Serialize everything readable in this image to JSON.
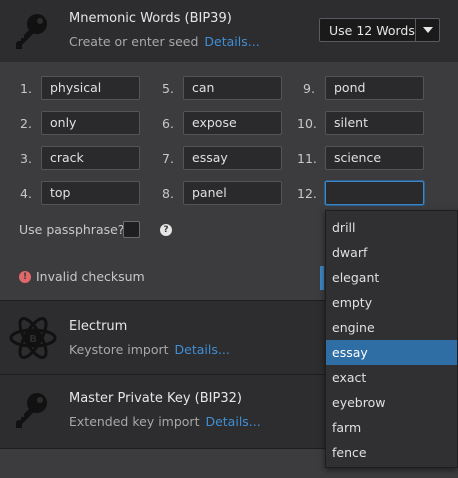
{
  "bip39": {
    "title": "Mnemonic Words (BIP39)",
    "subtitle": "Create or enter seed",
    "details": "Details...",
    "word_count": "Use 12 Words",
    "icon": "key-icon"
  },
  "words": [
    {
      "n": "1.",
      "word": "physical"
    },
    {
      "n": "2.",
      "word": "only"
    },
    {
      "n": "3.",
      "word": "crack"
    },
    {
      "n": "4.",
      "word": "top"
    },
    {
      "n": "5.",
      "word": "can"
    },
    {
      "n": "6.",
      "word": "expose"
    },
    {
      "n": "7.",
      "word": "essay"
    },
    {
      "n": "8.",
      "word": "panel"
    },
    {
      "n": "9.",
      "word": "pond"
    },
    {
      "n": "10.",
      "word": "silent"
    },
    {
      "n": "11.",
      "word": "science"
    },
    {
      "n": "12.",
      "word": ""
    }
  ],
  "passphrase": {
    "label": "Use passphrase?",
    "checked": false,
    "help_icon": "help-icon"
  },
  "error": {
    "text": "Invalid checksum",
    "icon": "error-icon",
    "color": "#e06868"
  },
  "electrum": {
    "title": "Electrum",
    "subtitle": "Keystore import",
    "details": "Details...",
    "icon": "electrum-atom-icon"
  },
  "bip32": {
    "title": "Master Private Key (BIP32)",
    "subtitle": "Extended key import",
    "details": "Details...",
    "icon": "key-icon"
  },
  "suggestions": {
    "items": [
      "drill",
      "dwarf",
      "elegant",
      "empty",
      "engine",
      "essay",
      "exact",
      "eyebrow",
      "farm",
      "fence"
    ],
    "selected": "essay"
  },
  "colors": {
    "accent": "#3f8fd6",
    "selection": "#2f6ea5",
    "panel": "#2d2d2f",
    "background": "#3c3c3e"
  }
}
